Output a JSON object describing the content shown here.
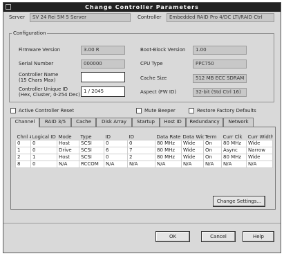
{
  "window": {
    "title": "Change Controller Parameters"
  },
  "header": {
    "server_label": "Server",
    "server_value": "SV 24 Rei 5M 5 Server",
    "controller_label": "Controller",
    "controller_value": "Embedded RAID Pro 4/DC LTI/RAID Ctrl"
  },
  "config": {
    "group_title": "Configuration",
    "firmware_label": "Firmware Version",
    "firmware_value": "3.00 R",
    "serial_label": "Serial Number",
    "serial_value": "000000",
    "name_label": "Controller Name\n(15 Chars Max)",
    "name_value": "",
    "unique_label": "Controller Unique ID\n(Hex, Cluster, 0-254 Dec)",
    "unique_value": "1 / 2045",
    "boot_label": "Boot-Block Version",
    "boot_value": "1.00",
    "cpu_label": "CPU Type",
    "cpu_value": "PPC750",
    "cache_label": "Cache Size",
    "cache_value": "512 MB ECC SDRAM",
    "aspect_label": "Aspect (FW ID)",
    "aspect_value": "32-bit (Std Ctrl 16)"
  },
  "options": {
    "hotplug_label": "Active Controller Reset",
    "alarm_label": "Mute Beeper",
    "restore_label": "Restore Factory Defaults"
  },
  "tabs": [
    "Channel",
    "RAID 3/5",
    "Cache",
    "Disk Array",
    "Startup",
    "Host ID",
    "Redundancy",
    "Network"
  ],
  "grid": {
    "columns": [
      "Chnl #",
      "Logical ID",
      "Mode",
      "Type",
      "ID",
      "ID",
      "Data Rate",
      "Data Width",
      "Term",
      "Curr Clk",
      "Curr Width"
    ],
    "rows": [
      [
        "0",
        "0",
        "Host",
        "SCSI",
        "0",
        "0",
        "80 MHz",
        "Wide",
        "On",
        "80 MHz",
        "Wide"
      ],
      [
        "1",
        "0",
        "Drive",
        "SCSI",
        "6",
        "7",
        "80 MHz",
        "Wide",
        "On",
        "Async",
        "Narrow"
      ],
      [
        "2",
        "1",
        "Host",
        "SCSI",
        "0",
        "2",
        "80 MHz",
        "Wide",
        "On",
        "80 MHz",
        "Wide"
      ],
      [
        "8",
        "0",
        "N/A",
        "RCCOM",
        "N/A",
        "N/A",
        "N/A",
        "N/A",
        "N/A",
        "N/A",
        "N/A"
      ]
    ]
  },
  "buttons": {
    "change_settings": "Change Settings...",
    "ok": "OK",
    "cancel": "Cancel",
    "help": "Help"
  }
}
